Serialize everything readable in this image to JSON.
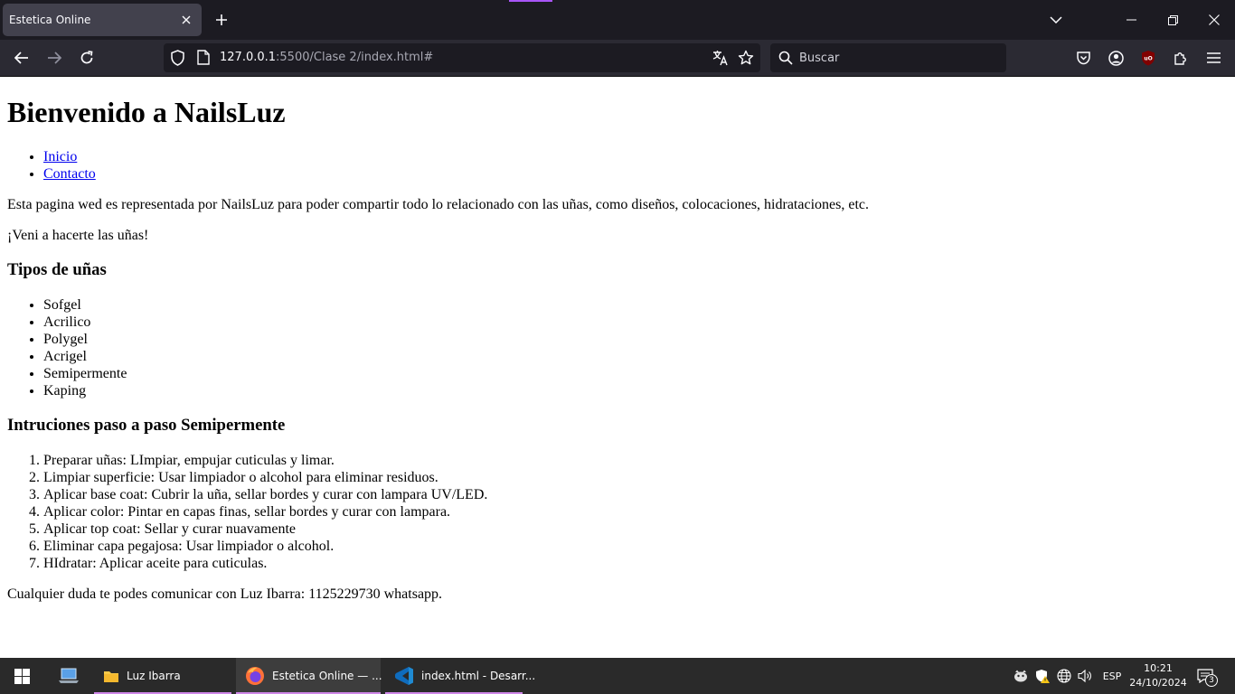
{
  "browser": {
    "tab": {
      "title": "Estetica Online",
      "close_icon": "close-icon"
    },
    "new_tab_icon": "plus-icon",
    "url": {
      "host": "127.0.0.1",
      "rest": ":5500/Clase 2/index.html#"
    },
    "search": {
      "placeholder": "Buscar"
    },
    "accent_color": "#a855f7"
  },
  "page": {
    "title": "Bienvenido a NailsLuz",
    "nav": [
      {
        "label": "Inicio"
      },
      {
        "label": "Contacto"
      }
    ],
    "intro": "Esta pagina wed es representada por NailsLuz para poder compartir todo lo relacionado con las uñas, como diseños, colocaciones, hidrataciones, etc.",
    "tagline": "¡Veni a hacerte las uñas!",
    "types_heading": "Tipos de uñas",
    "types": [
      "Sofgel",
      "Acrilico",
      "Polygel",
      "Acrigel",
      "Semipermente",
      "Kaping"
    ],
    "steps_heading": "Intruciones paso a paso Semipermente",
    "steps": [
      "Preparar uñas: LImpiar, empujar cuticulas y limar.",
      "Limpiar superficie: Usar limpiador o alcohol para eliminar residuos.",
      "Aplicar base coat: Cubrir la uña, sellar bordes y curar con lampara UV/LED.",
      "Aplicar color: Pintar en capas finas, sellar bordes y curar con lampara.",
      "Aplicar top coat: Sellar y curar nuavamente",
      "Eliminar capa pegajosa: Usar limpiador o alcohol.",
      "HIdratar: Aplicar aceite para cuticulas."
    ],
    "contact": "Cualquier duda te podes comunicar con Luz Ibarra: 1125229730 whatsapp."
  },
  "taskbar": {
    "apps": [
      {
        "label": "Luz Ibarra",
        "icon": "folder-icon"
      },
      {
        "label": "Estetica Online — ...",
        "icon": "firefox-icon"
      },
      {
        "label": "index.html - Desarr...",
        "icon": "vscode-icon"
      }
    ],
    "language": "ESP",
    "time": "10:21",
    "date": "24/10/2024",
    "notifications": "3"
  }
}
